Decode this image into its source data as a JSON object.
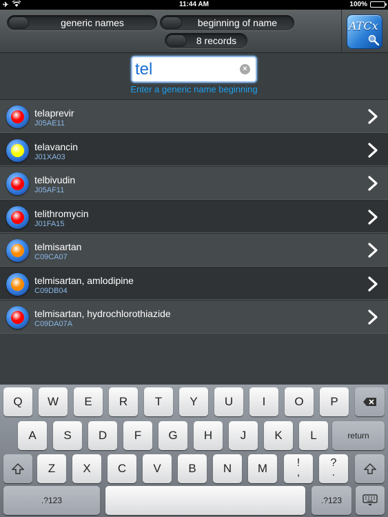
{
  "status_bar": {
    "time": "11:44 AM",
    "battery": "100%",
    "battery_level": 1.0
  },
  "toolbar": {
    "mode_toggle_label": "generic names",
    "match_toggle_label": "beginning of name",
    "records_label": "8 records",
    "logo_text": "ATCx"
  },
  "search": {
    "value": "tel",
    "hint": "Enter a generic name beginning"
  },
  "colors": {
    "red": "#ff0000",
    "yellow": "#ffff00",
    "orange": "#ff8a00",
    "hint_blue": "#1ea0f0",
    "code_blue": "#8ab8e8"
  },
  "results": [
    {
      "name": "telaprevir",
      "code": "J05AE11",
      "dot_color": "#ff0000"
    },
    {
      "name": "telavancin",
      "code": "J01XA03",
      "dot_color": "#ffff00"
    },
    {
      "name": "telbivudin",
      "code": "J05AF11",
      "dot_color": "#ff0000"
    },
    {
      "name": "telithromycin",
      "code": "J01FA15",
      "dot_color": "#ff0000"
    },
    {
      "name": "telmisartan",
      "code": "C09CA07",
      "dot_color": "#ff8a00"
    },
    {
      "name": "telmisartan, amlodipine",
      "code": "C09DB04",
      "dot_color": "#ff8a00"
    },
    {
      "name": "telmisartan, hydrochlorothiazide",
      "code": "C09DA07A",
      "dot_color": "#ff0000"
    }
  ],
  "keyboard": {
    "row1": [
      "Q",
      "W",
      "E",
      "R",
      "T",
      "Y",
      "U",
      "I",
      "O",
      "P"
    ],
    "backspace_icon": "backspace-icon",
    "row2": [
      "A",
      "S",
      "D",
      "F",
      "G",
      "H",
      "J",
      "K",
      "L"
    ],
    "return_label": "return",
    "row3": [
      "Z",
      "X",
      "C",
      "V",
      "B",
      "N",
      "M"
    ],
    "shift_icon": "shift-icon",
    "exclaim_top": "!",
    "exclaim_bottom": ",",
    "question_top": "?",
    "question_bottom": ".",
    "numbers_label": ".?123",
    "dismiss_icon": "keyboard-dismiss-icon"
  }
}
